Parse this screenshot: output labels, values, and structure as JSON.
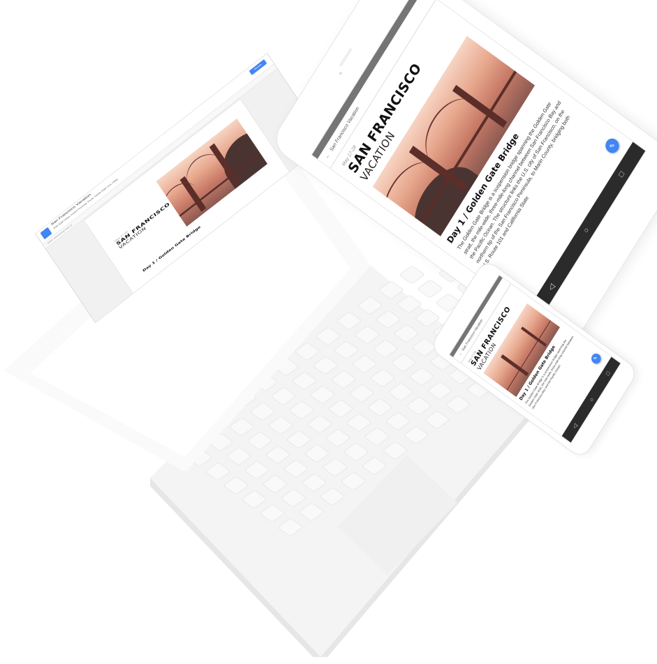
{
  "laptop": {
    "doc_window_title": "San Francisco Vacation",
    "menu_items": "File  Edit  View  Insert  Format  Tools  Table  Add-ons  Help",
    "toolbar_text": "100%   Normal text   Arial   11",
    "share_label": "Share"
  },
  "document": {
    "date": "May 17-28",
    "title_line1": "SAN FRANCISCO",
    "title_line2": "VACATION",
    "day_heading": "Day 1 / Golden Gate Bridge",
    "body": "The Golden Gate Bridge is a suspension bridge spanning the Golden Gate strait, the mile-wide, three-mile-long channel between San Francisco Bay and the Pacific Ocean. The structure links the U.S. city of San Francisco, on the northern tip of the San Francisco Peninsula, to Marin County, bridging both U.S. Route 101 and California State"
  },
  "tablet": {
    "appbar_title": "San Francisco Vacation",
    "nav_back": "◁",
    "nav_home": "○",
    "nav_recent": "□",
    "fab_icon": "pencil-icon"
  },
  "phone": {
    "appbar_title": "San Francisco Vacation",
    "body": "The Golden Gate Bridge is a suspension bridge spanning the Golden Gate strait, the mile-wide, three-mile-long channel between San Francisco Bay and the Pacific Ocean.",
    "nav_back": "◁",
    "nav_home": "○",
    "nav_recent": "□"
  },
  "colors": {
    "accent": "#4285f4",
    "device_white": "#ffffff",
    "device_edge": "#e6e6e6"
  }
}
